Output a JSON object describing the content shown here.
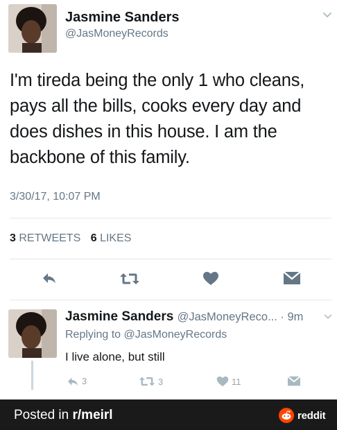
{
  "tweet": {
    "display_name": "Jasmine Sanders",
    "handle": "@JasMoneyRecords",
    "text": "I'm tireda being the only 1 who cleans, pays all the bills, cooks every day and does dishes in this house. I am the backbone of this family.",
    "timestamp": "3/30/17, 10:07 PM",
    "retweet_count": "3",
    "retweet_label": "RETWEETS",
    "like_count": "6",
    "like_label": "LIKES"
  },
  "reply": {
    "display_name": "Jasmine Sanders",
    "handle": "@JasMoneyReco...",
    "separator": " · ",
    "time": "9m",
    "replying_to": "Replying to @JasMoneyRecords",
    "text": "I live alone, but still",
    "reply_count": "3",
    "retweet_count": "3",
    "like_count": "11"
  },
  "footer": {
    "prefix": "Posted in ",
    "subreddit": "r/meirl",
    "brand": "reddit"
  },
  "icons": {
    "reply": "reply-icon",
    "retweet": "retweet-icon",
    "like": "heart-icon",
    "dm": "envelope-icon",
    "menu": "chevron-down-icon",
    "brand": "reddit-logo-icon"
  },
  "colors": {
    "icon_dark": "#657786",
    "icon_light": "#aab8c2",
    "footer_bg": "#1a1a1b",
    "reddit_orange": "#ff4500"
  }
}
